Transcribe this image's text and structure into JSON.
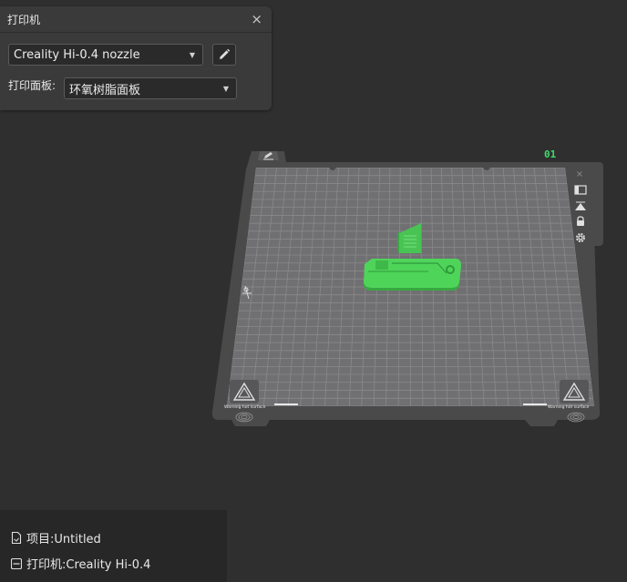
{
  "printer_panel": {
    "title": "打印机",
    "close_symbol": "×",
    "printer_select": {
      "value": "Creality Hi-0.4 nozzle"
    },
    "plate_label": "打印面板:",
    "plate_select": {
      "value": "环氧树脂面板"
    }
  },
  "bed": {
    "plate_number": "01",
    "warning_text_left": "Warning hot surface",
    "warning_text_right": "Warning hot surface"
  },
  "info_panel": {
    "project": {
      "icon": "file-icon",
      "label": "项目:Untitled"
    },
    "printer": {
      "icon": "printer-icon",
      "label": "打印机:Creality Hi-0.4"
    }
  },
  "colors": {
    "background": "#2f2f30",
    "panel": "#3a3a3b",
    "bed_frame": "#4a4a4b",
    "bed_surface": "#707072",
    "grid_line": "#8c8c8e",
    "model_green": "#4fd45a",
    "plate_number_green": "#3ddc6a"
  }
}
